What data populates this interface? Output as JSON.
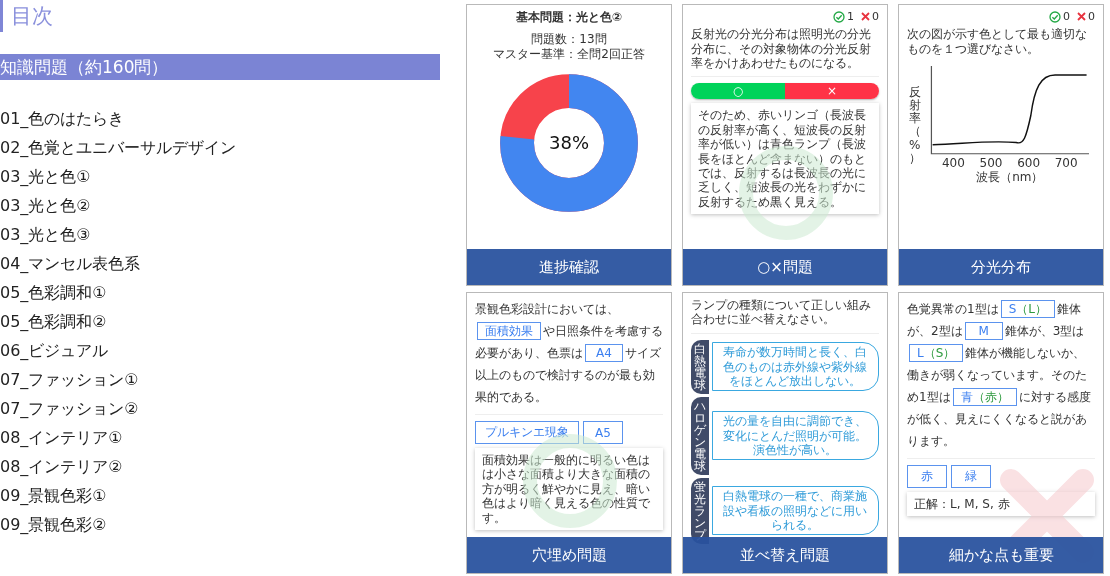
{
  "heading": "目次",
  "section": {
    "title": "知識問題（約160問）",
    "items": [
      "01_色のはたらき",
      "02_色覚とユニバーサルデザイン",
      "03_光と色①",
      "03_光と色②",
      "03_光と色③",
      "04_マンセル表色系",
      "05_色彩調和①",
      "05_色彩調和②",
      "06_ビジュアル",
      "07_ファッション①",
      "07_ファッション②",
      "08_インテリア①",
      "08_インテリア②",
      "09_景観色彩①",
      "09_景観色彩②"
    ]
  },
  "screens": [
    {
      "kind": "progress",
      "caption": "進捗確認",
      "title": "基本問題：光と色②",
      "lines": [
        "問題数：13問",
        "マスター基準：全問2回正答"
      ],
      "percent": "38%"
    },
    {
      "kind": "true_false",
      "caption": "○×問題",
      "correct_count": "1",
      "wrong_count": "0",
      "question": "反射光の分光分布は照明光の分光分布に、その対象物体の分光反射率をかけあわせたものになる。",
      "options": [
        "○",
        "×"
      ],
      "explanation": "そのため、赤いリンゴ（長波長の反射率が高く、短波長の反射率が低い）は青色ランプ（長波長をほとんど含まない）のもとでは、反射するは長波長の光に乏しく、短波長の光をわずかに反射するため黒く見える。",
      "answered_correctly": true
    },
    {
      "kind": "spectrum",
      "caption": "分光分布",
      "correct_count": "0",
      "wrong_count": "0",
      "question": "次の図が示す色として最も適切なものを１つ選びなさい。",
      "figure": {
        "ylabel": "反射率（%）",
        "xlabel": "波長（nm）",
        "xticks": [
          "400",
          "500",
          "600",
          "700"
        ]
      }
    },
    {
      "kind": "fill_in",
      "caption": "穴埋め問題",
      "parts": [
        {
          "kind": "text",
          "text": "景観色彩設計においては、"
        },
        {
          "kind": "blank",
          "text": "面積効果"
        },
        {
          "kind": "text",
          "text": "や日照条件を考慮する必要があり、色票は"
        },
        {
          "kind": "blank",
          "text": "A4"
        },
        {
          "kind": "text",
          "text": "サイズ以上のもので検討するのが最も効果的である。"
        }
      ],
      "options": [
        "プルキンエ現象",
        "A5"
      ],
      "explanation": "面積効果は一般的に明るい色はは小さな面積より大きな面積の方が明るく鮮やかに見え、暗い色はより暗く見える色の性質です。",
      "answered_correctly": true
    },
    {
      "kind": "ordering",
      "caption": "並べ替え問題",
      "question": "ランプの種類について正しい組み合わせに並べ替えなさい。",
      "items": [
        {
          "label": "白熱電球",
          "text": "寿命が数万時間と長く、白色のものは赤外線や紫外線をほとんど放出しない。"
        },
        {
          "label": "ハロゲン電球",
          "text": "光の量を自由に調節でき、変化にとんだ照明が可能。演色性が高い。"
        },
        {
          "label": "蛍光ランプ",
          "text": "白熱電球の一種で、商業施設や看板の照明などに用いられる。"
        }
      ]
    },
    {
      "kind": "fill_in",
      "caption": "細かな点も重要",
      "parts": [
        {
          "kind": "text",
          "text": "色覚異常の1型は"
        },
        {
          "kind": "blank",
          "text": "S",
          "note": "（L）"
        },
        {
          "kind": "text",
          "text": "錐体が、2型は"
        },
        {
          "kind": "blank",
          "text": "M"
        },
        {
          "kind": "text",
          "text": "錐体が、3型は"
        },
        {
          "kind": "blank",
          "text": "L",
          "note": "（S）"
        },
        {
          "kind": "text",
          "text": "錐体が機能しないか、働きが弱くなっています。そのため1型は"
        },
        {
          "kind": "blank",
          "text": "青",
          "note": "（赤）"
        },
        {
          "kind": "text",
          "text": "に対する感度が低く、見えにくくなると説があります。"
        }
      ],
      "options": [
        "赤",
        "緑"
      ],
      "answer": "正解：L, M, S, 赤",
      "answered_correctly": false
    }
  ]
}
